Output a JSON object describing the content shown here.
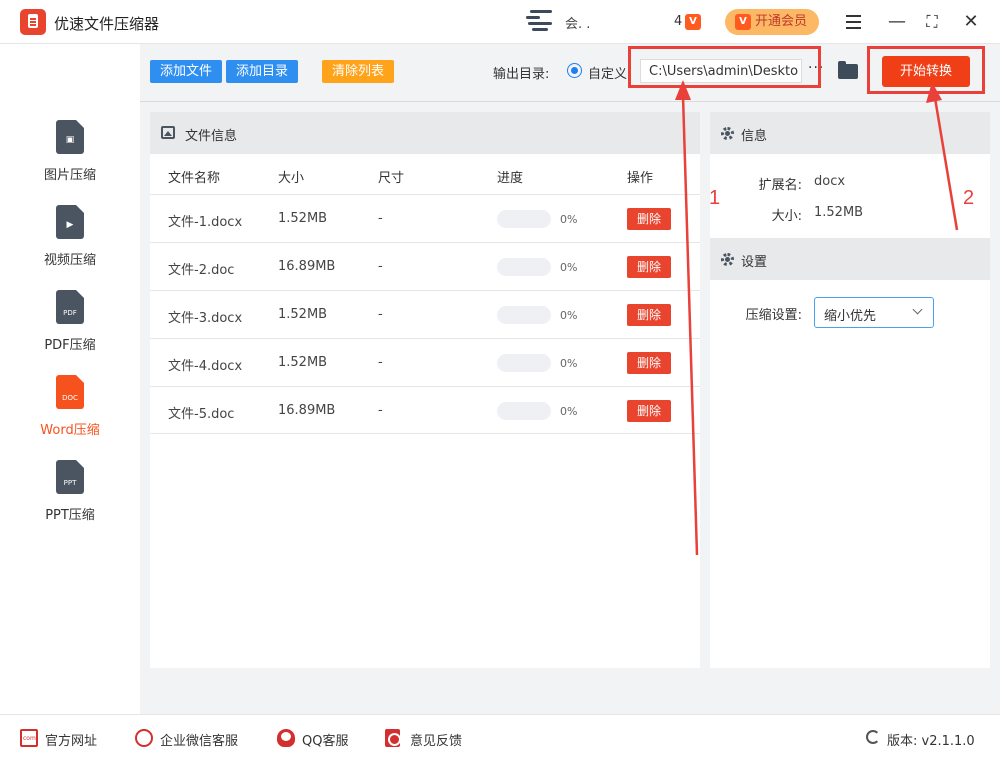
{
  "window": {
    "title": "优速文件压缩器",
    "user_name": "会. .",
    "level_number": "4",
    "level_badge": "V",
    "vip_label": "开通会员",
    "vip_badge": "V"
  },
  "sidebar": {
    "items": [
      {
        "label": "图片压缩",
        "tag": "",
        "icon": "image-doc-icon",
        "active": false
      },
      {
        "label": "视频压缩",
        "tag": "",
        "icon": "video-doc-icon",
        "active": false
      },
      {
        "label": "PDF压缩",
        "tag": "PDF",
        "icon": "pdf-doc-icon",
        "active": false
      },
      {
        "label": "Word压缩",
        "tag": "DOC",
        "icon": "word-doc-icon",
        "active": true
      },
      {
        "label": "PPT压缩",
        "tag": "PPT",
        "icon": "ppt-doc-icon",
        "active": false
      }
    ]
  },
  "toolbar": {
    "add_file": "添加文件",
    "add_dir": "添加目录",
    "clear_list": "清除列表",
    "output_label": "输出目录:",
    "custom_label": "自定义",
    "output_path": "C:\\Users\\admin\\Deskto",
    "more": "···",
    "start": "开始转换"
  },
  "annotations": {
    "marker_1": "1",
    "marker_2": "2",
    "color": "#e9403a"
  },
  "files_panel": {
    "title": "文件信息",
    "columns": {
      "name": "文件名称",
      "size": "大小",
      "dimension": "尺寸",
      "progress": "进度",
      "action": "操作"
    },
    "rows": [
      {
        "name": "文件-1.docx",
        "size": "1.52MB",
        "dimension": "-",
        "progress": "0%",
        "delete": "删除"
      },
      {
        "name": "文件-2.doc",
        "size": "16.89MB",
        "dimension": "-",
        "progress": "0%",
        "delete": "删除"
      },
      {
        "name": "文件-3.docx",
        "size": "1.52MB",
        "dimension": "-",
        "progress": "0%",
        "delete": "删除"
      },
      {
        "name": "文件-4.docx",
        "size": "1.52MB",
        "dimension": "-",
        "progress": "0%",
        "delete": "删除"
      },
      {
        "name": "文件-5.doc",
        "size": "16.89MB",
        "dimension": "-",
        "progress": "0%",
        "delete": "删除"
      }
    ]
  },
  "info_panel": {
    "title": "信息",
    "ext_label": "扩展名:",
    "ext_value": "docx",
    "size_label": "大小:",
    "size_value": "1.52MB"
  },
  "settings_panel": {
    "title": "设置",
    "compress_label": "压缩设置:",
    "compress_value": "缩小优先"
  },
  "footer": {
    "website": "官方网址",
    "wechat": "企业微信客服",
    "qq": "QQ客服",
    "feedback": "意见反馈",
    "version": "版本: v2.1.1.0"
  },
  "colors": {
    "accent_red": "#f03e17",
    "button_blue": "#2e8ff0",
    "button_orange": "#ffa31a",
    "active_orange": "#f5521e"
  }
}
